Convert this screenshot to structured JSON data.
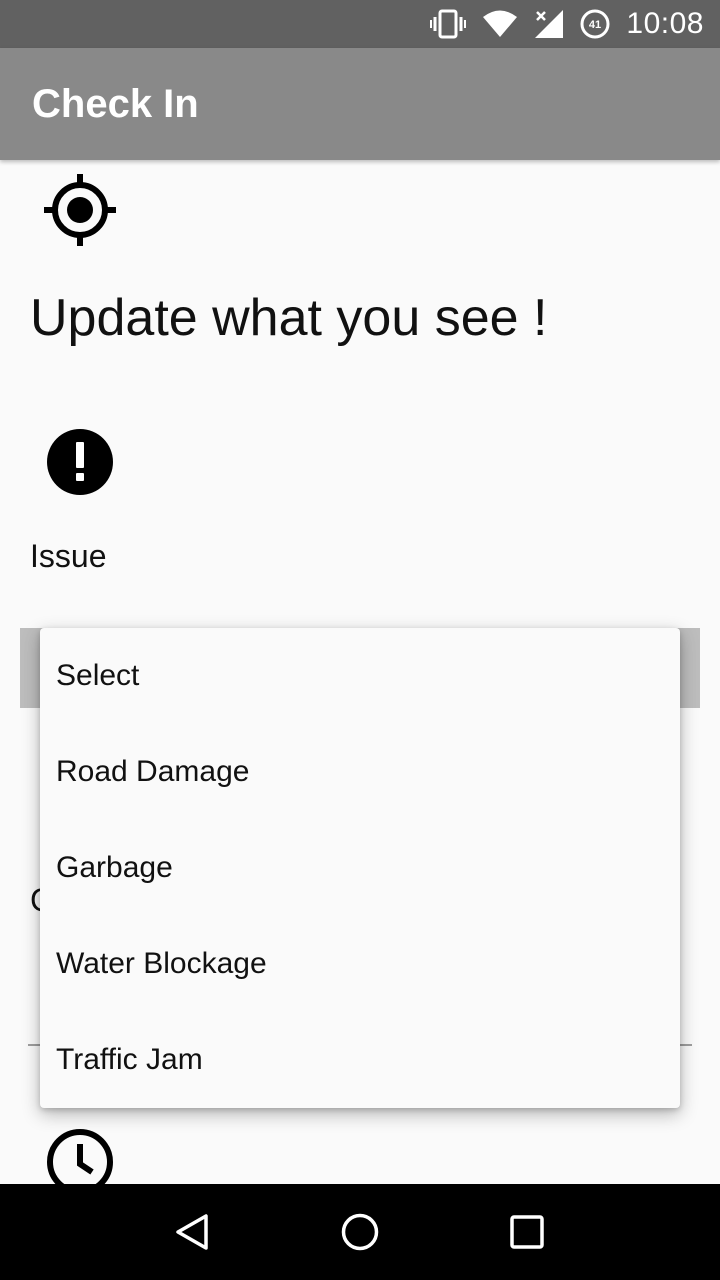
{
  "status_bar": {
    "time": "10:08",
    "battery_level": "41",
    "icons": [
      "vibrate-icon",
      "wifi-icon",
      "signal-icon",
      "battery-icon"
    ]
  },
  "app_bar": {
    "title": "Check In"
  },
  "main": {
    "heading": "Update what you see !",
    "issue_label": "Issue",
    "partial_label": "C"
  },
  "dropdown": {
    "options": [
      "Select",
      "Road Damage",
      "Garbage",
      "Water Blockage",
      "Traffic Jam"
    ]
  },
  "colors": {
    "status_bar": "#616161",
    "app_bar": "#898989",
    "background": "#fafafa",
    "nav_bar": "#000000"
  }
}
